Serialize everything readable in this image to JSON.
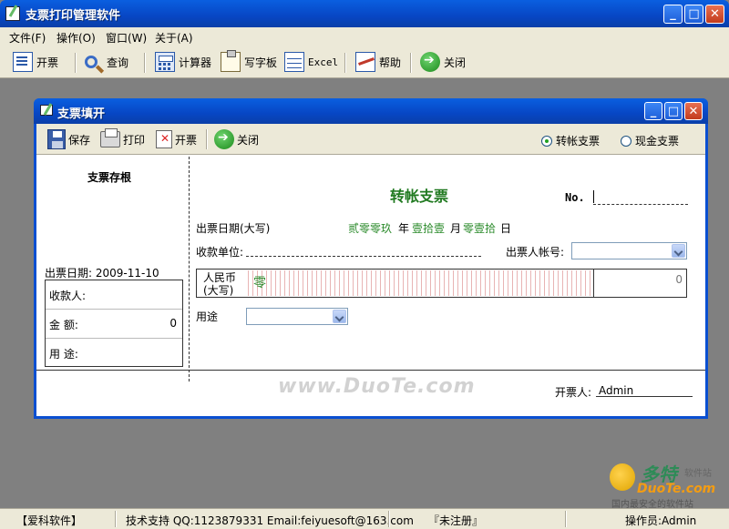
{
  "app": {
    "title": "支票打印管理软件",
    "window_buttons": [
      "_",
      "□",
      "✕"
    ]
  },
  "menu": [
    "文件(F)",
    "操作(O)",
    "窗口(W)",
    "关于(A)"
  ],
  "toolbar": {
    "issue": "开票",
    "query": "查询",
    "calculator": "计算器",
    "wordpad": "写字板",
    "excel": "Excel",
    "help": "帮助",
    "close": "关闭"
  },
  "child": {
    "title": "支票填开",
    "toolbar": {
      "save": "保存",
      "print": "打印",
      "issue": "开票",
      "close": "关闭"
    },
    "radio": {
      "transfer": "转帐支票",
      "cash": "现金支票",
      "selected": "transfer"
    },
    "stub": {
      "title": "支票存根",
      "date_label": "出票日期:",
      "date_value": "2009-11-10",
      "payee_label": "收款人:",
      "amount_label": "金  额:",
      "amount_value": "0",
      "purpose_label": "用  途:"
    },
    "check": {
      "title": "转帐支票",
      "no_label": "No.",
      "date_label": "出票日期(大写)",
      "date_year": "贰零零玖",
      "year_unit": "年",
      "date_month": "壹拾壹",
      "month_unit": "月",
      "date_day": "零壹拾",
      "day_unit": "日",
      "payee_label": "收款单位:",
      "account_label": "出票人帐号:",
      "rmb_label_1": "人民币",
      "rmb_label_2": "(大写)",
      "amount_words": "零",
      "amount_number": "0",
      "purpose_label": "用途",
      "issuer_label": "开票人:",
      "issuer_value": "Admin"
    },
    "watermark": "www.DuoTe.com"
  },
  "status": {
    "company": "【爱科软件】",
    "support": "技术支持 QQ:1123879331 Email:feiyuesoft@163.com",
    "registration": "『未注册』",
    "operator": "操作员:Admin"
  },
  "logo": {
    "name": "多特",
    "small": "软件站",
    "domain": "DuoTe.com",
    "tagline": "国内最安全的软件站"
  }
}
